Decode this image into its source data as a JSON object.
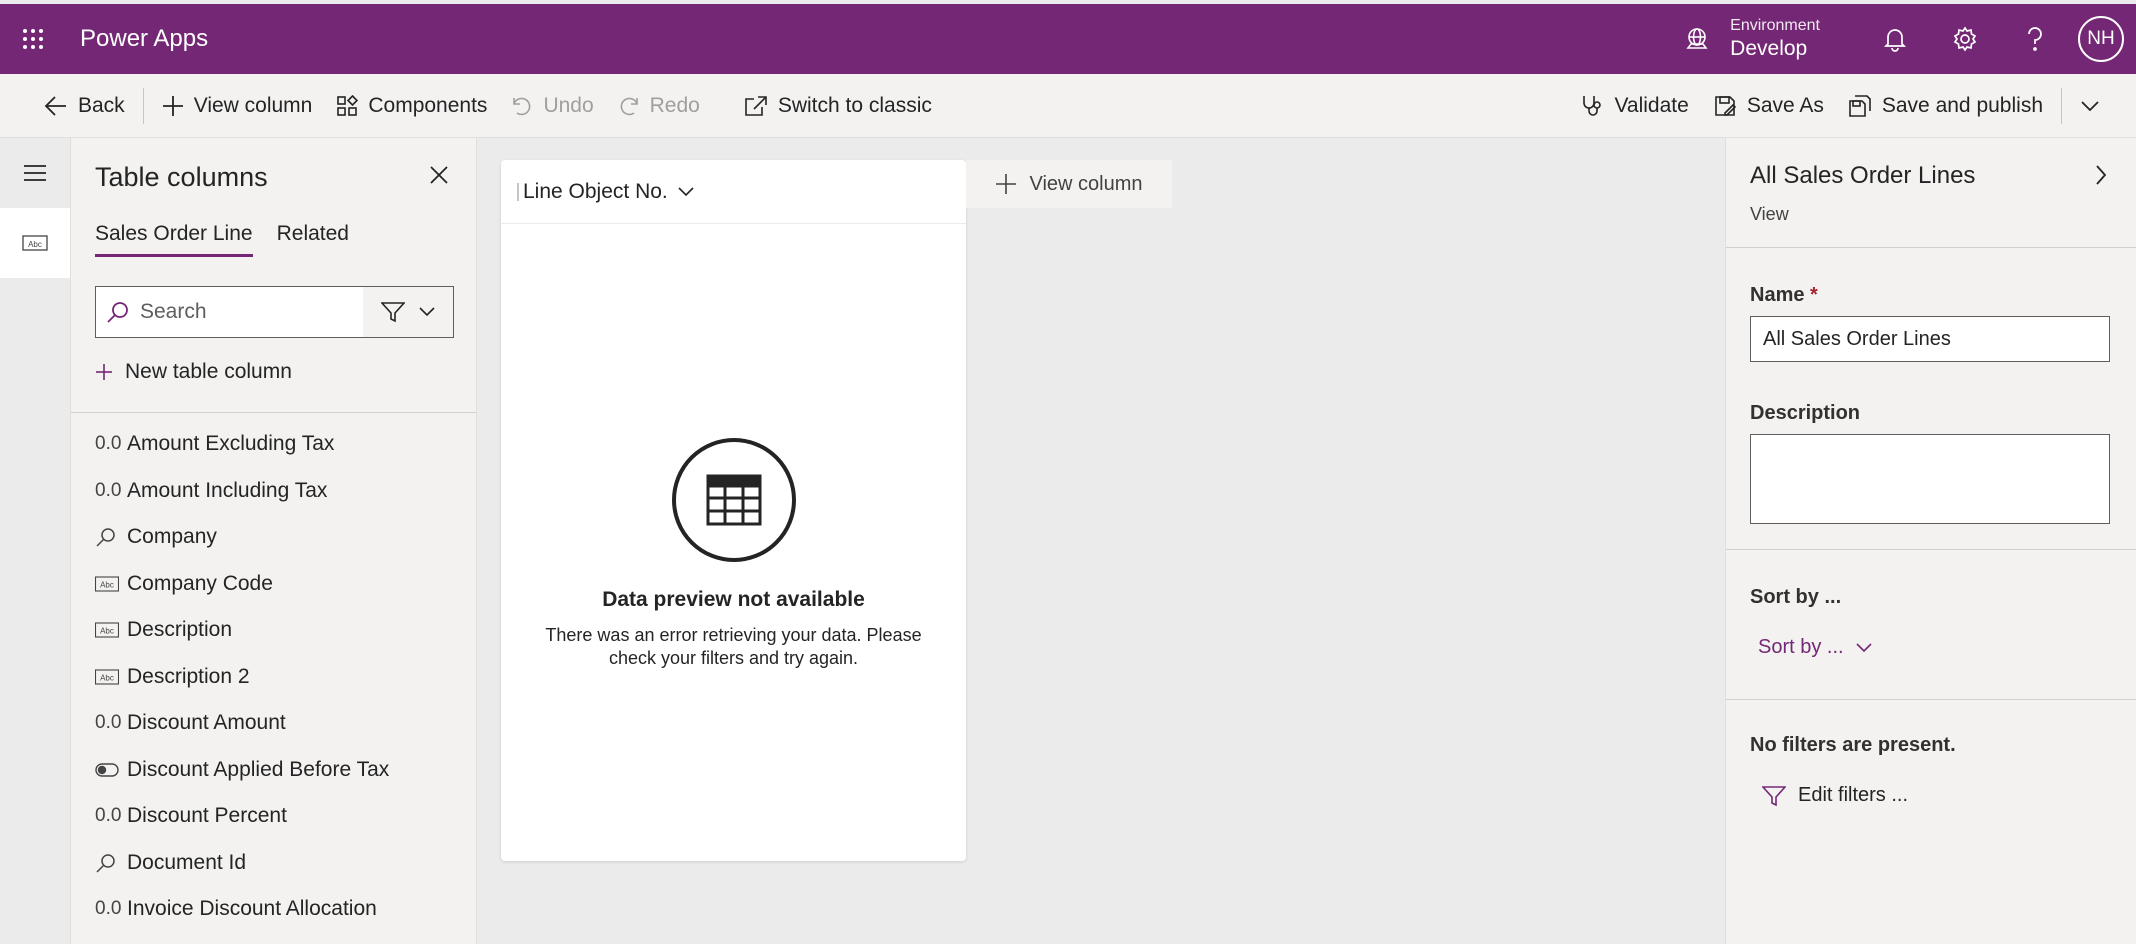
{
  "header": {
    "app_name": "Power Apps",
    "environment_label": "Environment",
    "environment_name": "Develop",
    "avatar_initials": "NH",
    "brand_color": "#742774"
  },
  "commandbar": {
    "back": "Back",
    "view_column": "View column",
    "components": "Components",
    "undo": "Undo",
    "redo": "Redo",
    "switch_classic": "Switch to classic",
    "validate": "Validate",
    "save_as": "Save As",
    "save_publish": "Save and publish"
  },
  "columns_panel": {
    "title": "Table columns",
    "tabs": [
      {
        "label": "Sales Order Line",
        "active": true
      },
      {
        "label": "Related",
        "active": false
      }
    ],
    "search_placeholder": "Search",
    "new_column": "New table column",
    "items": [
      {
        "icon": "0.0",
        "label": "Amount Excluding Tax"
      },
      {
        "icon": "0.0",
        "label": "Amount Including Tax"
      },
      {
        "icon": "lookup",
        "label": "Company"
      },
      {
        "icon": "abc",
        "label": "Company Code"
      },
      {
        "icon": "abc",
        "label": "Description"
      },
      {
        "icon": "abc",
        "label": "Description 2"
      },
      {
        "icon": "0.0",
        "label": "Discount Amount"
      },
      {
        "icon": "toggle",
        "label": "Discount Applied Before Tax"
      },
      {
        "icon": "0.0",
        "label": "Discount Percent"
      },
      {
        "icon": "lookup",
        "label": "Document Id"
      },
      {
        "icon": "0.0",
        "label": "Invoice Discount Allocation"
      }
    ]
  },
  "grid": {
    "column_header": "Line Object No.",
    "add_view_column": "View column",
    "preview_title": "Data preview not available",
    "preview_message": "There was an error retrieving your data. Please check your filters and try again."
  },
  "properties": {
    "title": "All Sales Order Lines",
    "subtitle": "View",
    "name_label": "Name",
    "name_required": "*",
    "name_value": "All Sales Order Lines",
    "description_label": "Description",
    "description_value": "",
    "sort_label": "Sort by ...",
    "sort_link": "Sort by ...",
    "no_filters": "No filters are present.",
    "edit_filters": "Edit filters ..."
  }
}
